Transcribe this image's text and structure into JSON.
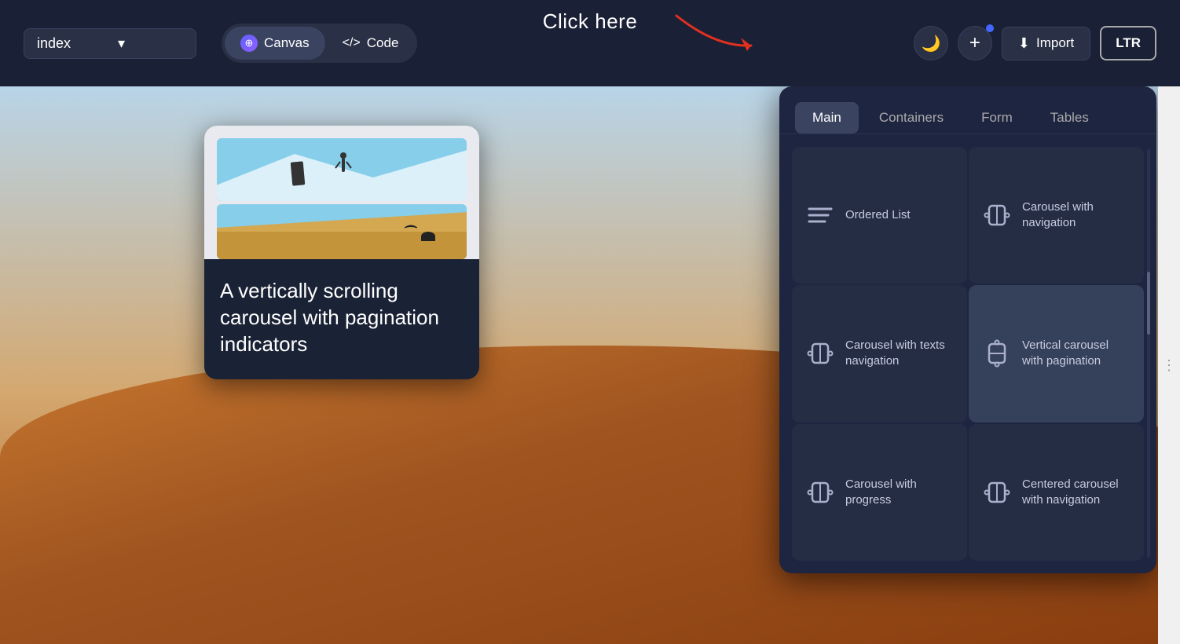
{
  "topbar": {
    "click_here_label": "Click here",
    "page_selector": {
      "value": "index",
      "arrow": "▾"
    },
    "mode_canvas_label": "Canvas",
    "mode_code_label": "Code",
    "dark_mode_icon": "🌙",
    "plus_icon": "+",
    "import_label": "Import",
    "ltr_label": "LTR"
  },
  "preview": {
    "card_text": "A vertically scrolling carousel with pagination indicators"
  },
  "panel": {
    "tabs": [
      "Main",
      "Containers",
      "Form",
      "Tables"
    ],
    "active_tab": "Main",
    "components": [
      {
        "id": "ordered-list",
        "label": "Ordered List",
        "icon_type": "list",
        "selected": false
      },
      {
        "id": "carousel-navigation",
        "label": "Carousel with navigation",
        "icon_type": "carousel",
        "selected": false
      },
      {
        "id": "carousel-texts-navigation",
        "label": "Carousel with texts navigation",
        "icon_type": "carousel",
        "selected": false
      },
      {
        "id": "vertical-carousel-pagination",
        "label": "Vertical carousel with pagination",
        "icon_type": "carousel",
        "selected": true
      },
      {
        "id": "carousel-progress",
        "label": "Carousel with progress",
        "icon_type": "carousel",
        "selected": false
      },
      {
        "id": "centered-carousel-navigation",
        "label": "Centered carousel with navigation",
        "icon_type": "carousel",
        "selected": false
      }
    ]
  }
}
